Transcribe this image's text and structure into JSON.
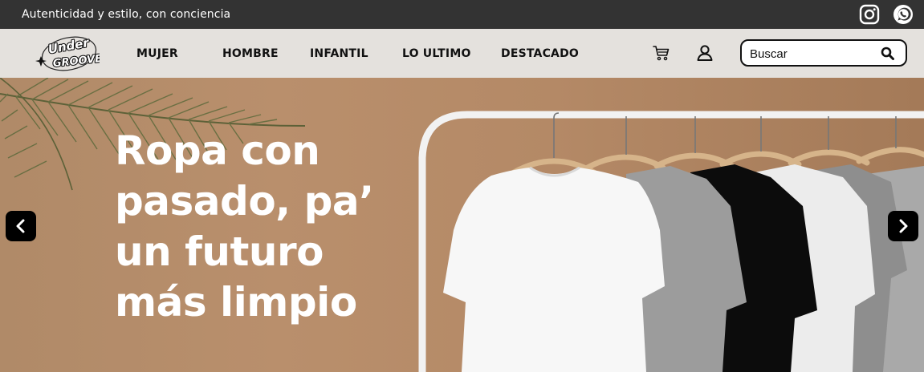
{
  "topbar": {
    "tagline": "Autenticidad y estilo, con conciencia",
    "social_icons": [
      "instagram-icon",
      "whatsapp-icon"
    ]
  },
  "header": {
    "logo_text": "Under Groove",
    "nav": [
      {
        "label": "MUJER"
      },
      {
        "label": "HOMBRE"
      },
      {
        "label": "INFANTIL"
      },
      {
        "label": "LO ULTIMO"
      },
      {
        "label": "DESTACADO"
      }
    ],
    "icons": [
      "cart-icon",
      "user-icon"
    ],
    "search": {
      "placeholder": "Buscar",
      "value": "",
      "icon": "search-icon"
    }
  },
  "hero": {
    "headline": "Ropa con pasado, pa’ un futuro más limpio",
    "controls": [
      "chevron-left-icon",
      "chevron-right-icon"
    ]
  },
  "colors": {
    "topbar_bg": "#333333",
    "nav_bg": "#e4e1dd",
    "hero_bg": "#b38a67",
    "text_light": "#ffffff",
    "text_dark": "#111111"
  }
}
